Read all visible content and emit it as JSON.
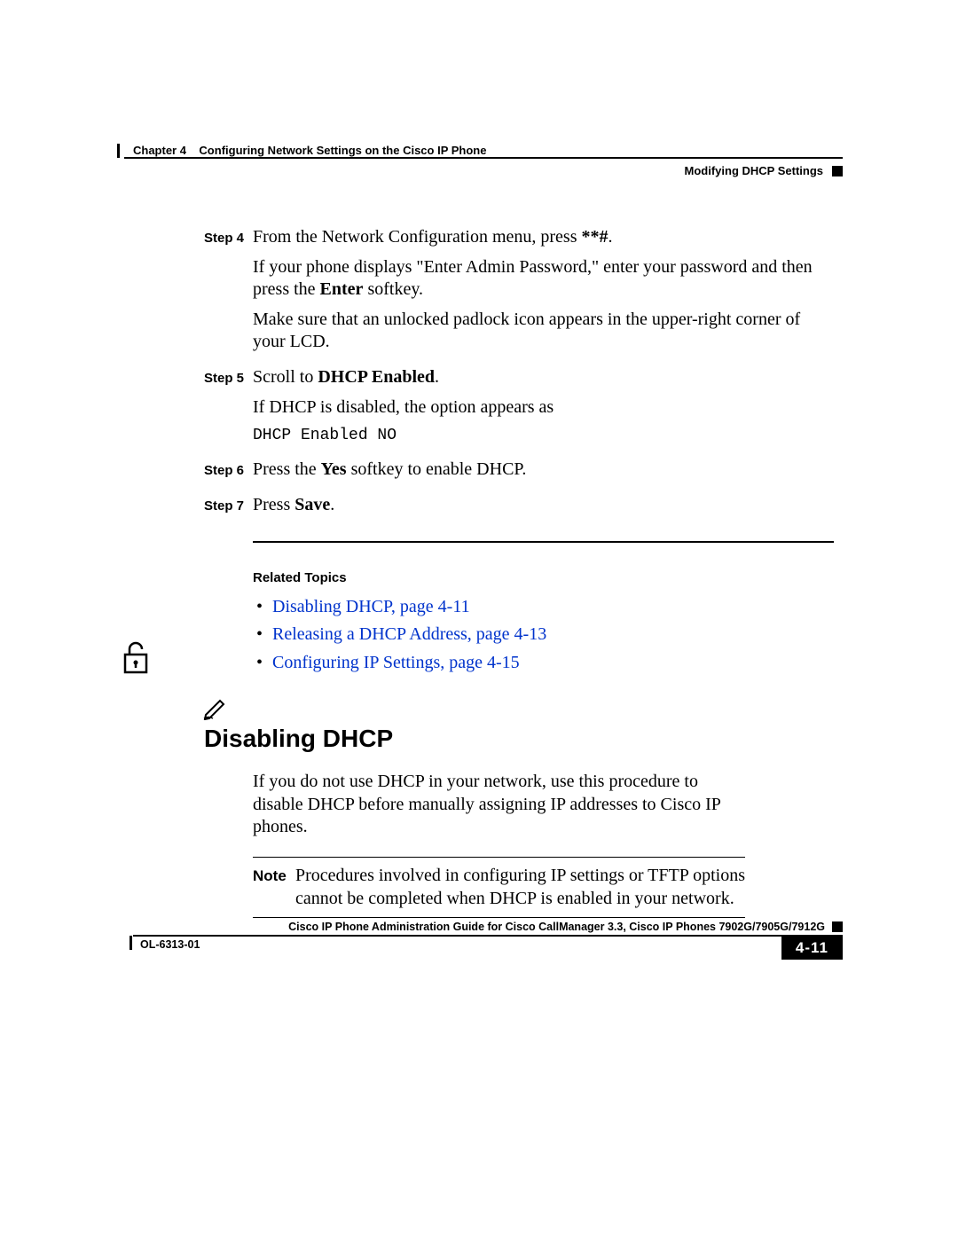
{
  "header": {
    "chapter": "Chapter 4",
    "chapter_title": "Configuring Network Settings on the Cisco IP Phone",
    "section": "Modifying DHCP Settings"
  },
  "steps": {
    "s4": {
      "label": "Step 4",
      "p1a": "From the Network Configuration menu, press ",
      "p1b": "**#",
      "p1c": ".",
      "p2a": "If your phone displays \"Enter Admin Password,\" enter your password and then press the ",
      "p2b": "Enter",
      "p2c": " softkey.",
      "p3": "Make sure that an unlocked padlock icon appears in the upper-right corner of your LCD."
    },
    "s5": {
      "label": "Step 5",
      "p1a": "Scroll to ",
      "p1b": "DHCP Enabled",
      "p1c": ".",
      "p2": "If DHCP is disabled, the option appears as",
      "code": "DHCP Enabled NO"
    },
    "s6": {
      "label": "Step 6",
      "p1a": "Press the ",
      "p1b": "Yes",
      "p1c": " softkey to enable DHCP."
    },
    "s7": {
      "label": "Step 7",
      "p1a": "Press ",
      "p1b": "Save",
      "p1c": "."
    }
  },
  "related": {
    "heading": "Related Topics",
    "items": [
      "Disabling DHCP, page 4-11",
      "Releasing a DHCP Address, page 4-13",
      "Configuring IP Settings, page 4-15"
    ]
  },
  "section2": {
    "title": "Disabling DHCP",
    "intro": "If you do not use DHCP in your network, use this procedure to disable DHCP before manually assigning IP addresses to Cisco IP phones.",
    "note_label": "Note",
    "note_text": "Procedures involved in configuring IP settings or TFTP options cannot be completed when DHCP is enabled in your network."
  },
  "footer": {
    "guide": "Cisco IP Phone Administration Guide for Cisco CallManager 3.3, Cisco IP Phones 7902G/7905G/7912G",
    "docnum": "OL-6313-01",
    "page": "4-11"
  },
  "icons": {
    "lock": "unlocked-padlock-icon",
    "pencil": "pencil-note-icon"
  }
}
